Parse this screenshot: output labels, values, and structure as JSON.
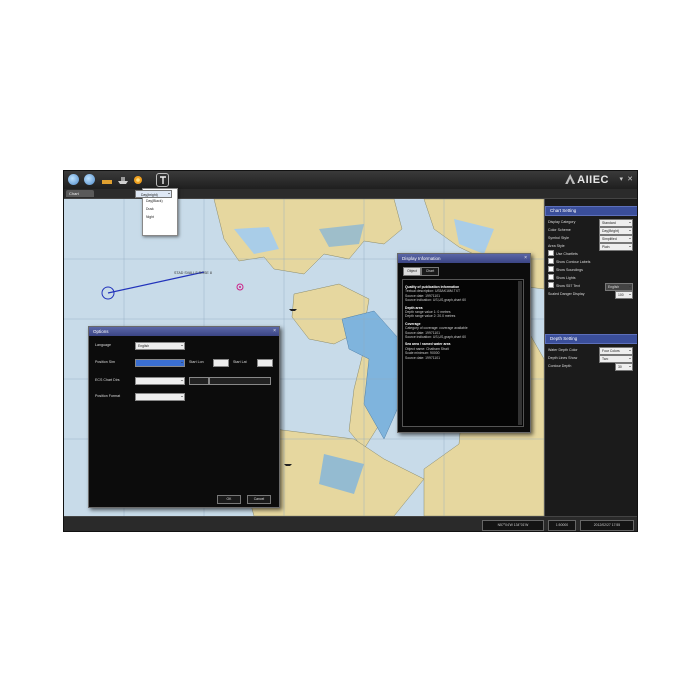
{
  "toolbar": {
    "dropdown_items": [
      "Day(bright)",
      "Day(White)",
      "Day(Black)",
      "Dusk",
      "Night"
    ]
  },
  "app": {
    "logo_text": "AIIEC"
  },
  "tabs": [
    {
      "label": "Chart"
    }
  ],
  "map_labels": [
    "STAD SVALLS ROSE 8"
  ],
  "chart_setting": {
    "title": "Chart Setting",
    "rows": [
      {
        "label": "Display Category",
        "value": "Standard"
      },
      {
        "label": "Color Scheme",
        "value": "Day(Bright)"
      },
      {
        "label": "Symbol Style",
        "value": "Simplified"
      },
      {
        "label": "Area Style",
        "value": "Plain"
      }
    ],
    "checks": [
      {
        "label": "Use Chartlets"
      },
      {
        "label": "Show Contour Labels"
      },
      {
        "label": "Show Soundings"
      },
      {
        "label": "Show Lights"
      }
    ],
    "show_s57": {
      "label": "Show S57 Text",
      "value": "English"
    },
    "scale_row": {
      "label": "Scaled Danger Display",
      "value": "100"
    }
  },
  "depth_setting": {
    "title": "Depth Setting",
    "rows": [
      {
        "label": "Water Depth Color",
        "value": "Four Colors"
      },
      {
        "label": "Depth Lines Show",
        "value": "Two"
      },
      {
        "label": "Contour Depth",
        "value": "30"
      }
    ]
  },
  "statusbar": {
    "coords": "N57°04'W 134°01'W",
    "scale": "1:50000",
    "datetime": "2012/02/27 17:55"
  },
  "options_dialog": {
    "title": "Options",
    "rows": [
      {
        "label": "Language",
        "value": "English"
      },
      {
        "label": "Position Sim",
        "value": ""
      },
      {
        "label": "ECS Chart Dirs",
        "value": ""
      },
      {
        "label": "Position Format",
        "value": ""
      }
    ],
    "inline_labels": [
      "Start Lon",
      "Start Lat"
    ],
    "ok": "OK",
    "cancel": "Cancel"
  },
  "info_dialog": {
    "title": "Display Information",
    "tabs": [
      "Object",
      "Chart"
    ],
    "lines": [
      {
        "text": "Quality of publication information",
        "bold": true
      },
      {
        "text": "Textual description: US5AK16M.TXT",
        "bold": false
      },
      {
        "text": "Source date: 19971101",
        "bold": false
      },
      {
        "text": "Source indication: US,US,graph,chart 60",
        "bold": false
      },
      {
        "text": "Depth area",
        "bold": true
      },
      {
        "text": "Depth range value 1: 0 metres",
        "bold": false
      },
      {
        "text": "Depth range value 2: 20.0 metres",
        "bold": false
      },
      {
        "text": "Coverage",
        "bold": true
      },
      {
        "text": "Category of coverage: coverage available",
        "bold": false
      },
      {
        "text": "Source date: 19971101",
        "bold": false
      },
      {
        "text": "Source indication: US,US,graph,chart 60",
        "bold": false
      },
      {
        "text": "Sea area / named water area",
        "bold": true
      },
      {
        "text": "Object name: Chatham Strait",
        "bold": false
      },
      {
        "text": "Scale minimum: 90000",
        "bold": false
      },
      {
        "text": "Source date: 19971101",
        "bold": false
      }
    ]
  },
  "colors": {
    "water": "#c8dbe9",
    "land": "#e6d79f",
    "shallow": "#7fb4dd",
    "panel_header": "#3a4e9a"
  }
}
